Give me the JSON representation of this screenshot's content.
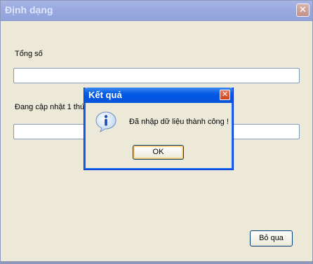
{
  "main_window": {
    "title": "Định dạng",
    "close_glyph": "✕",
    "fields": [
      {
        "label": "Tổng số",
        "value": ""
      },
      {
        "label": "Đang cập nhật 1 thứ",
        "value": ""
      }
    ],
    "skip_label": "Bỏ qua"
  },
  "dialog": {
    "title": "Kết quả",
    "close_glyph": "✕",
    "icon": "info-icon",
    "message": "Đã nhập dữ liệu thành công !",
    "ok_label": "OK"
  },
  "colors": {
    "inactive_titlebar": "#9aaae0",
    "active_titlebar": "#0054e3",
    "face": "#ece9d8"
  }
}
